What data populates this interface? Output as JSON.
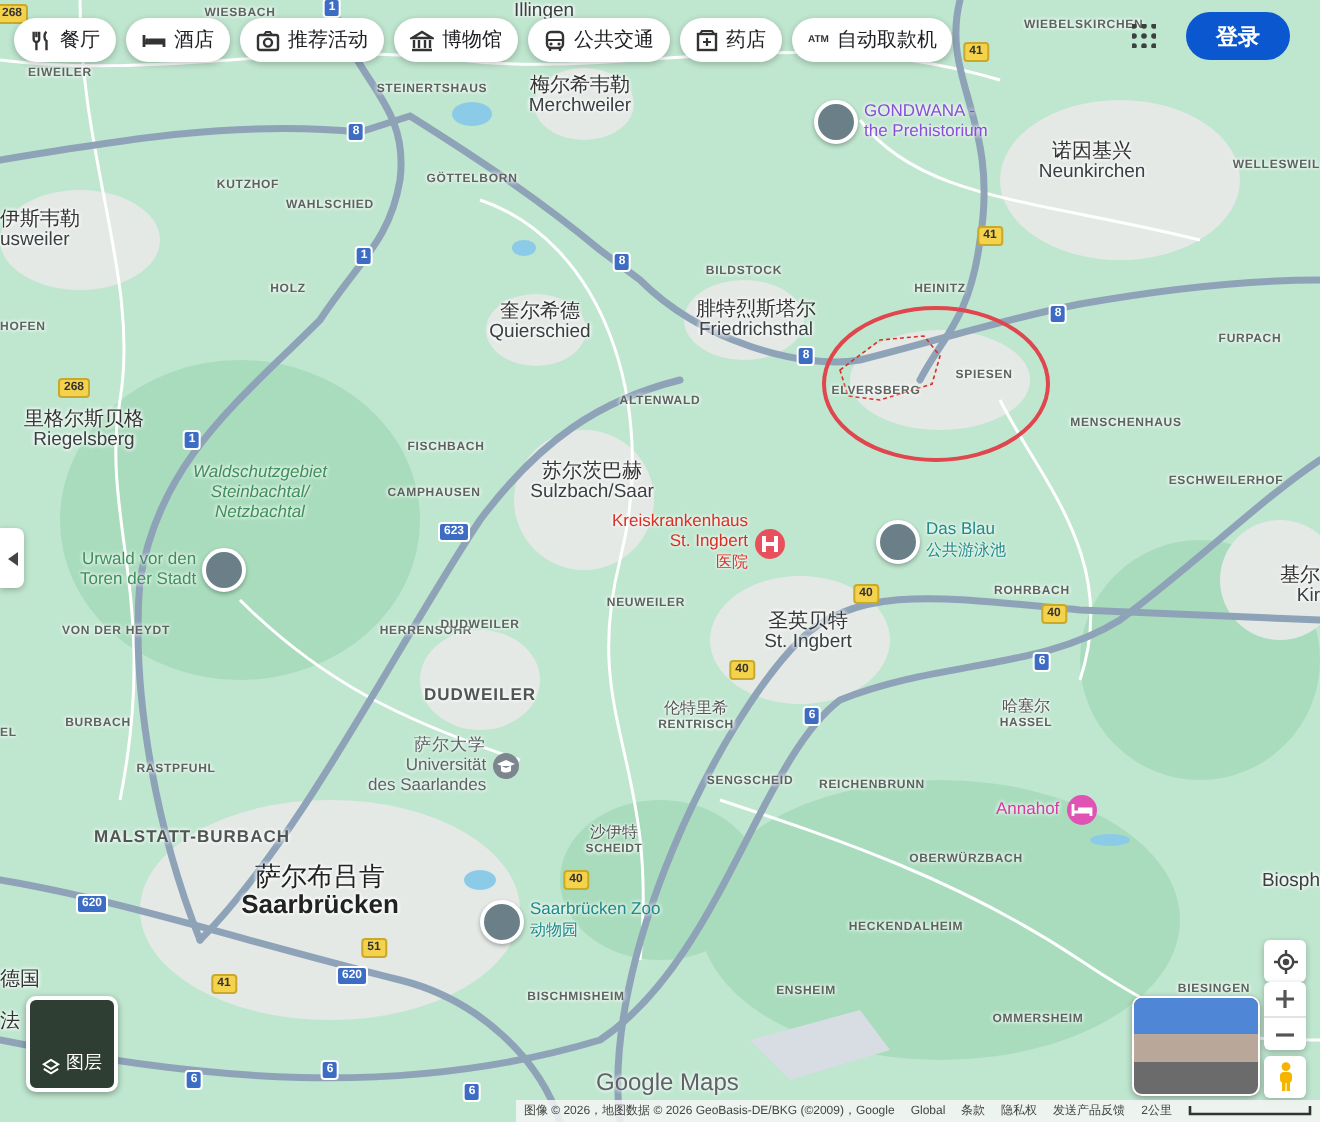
{
  "categories": [
    {
      "kind": "restaurant",
      "label": "餐厅"
    },
    {
      "kind": "hotel",
      "label": "酒店"
    },
    {
      "kind": "activity",
      "label": "推荐活动"
    },
    {
      "kind": "museum",
      "label": "博物馆"
    },
    {
      "kind": "transit",
      "label": "公共交通"
    },
    {
      "kind": "pharmacy",
      "label": "药店"
    },
    {
      "kind": "atm",
      "label": "自动取款机",
      "badge": "ATM"
    }
  ],
  "sign_in": "登录",
  "places": [
    {
      "kind": "locality",
      "text": "WIESBACH"
    },
    {
      "kind": "locality",
      "text": "EIWEILER"
    },
    {
      "kind": "locality",
      "text": "STEINERTSHAUS"
    },
    {
      "kind": "locality",
      "text": "KUTZHOF"
    },
    {
      "kind": "locality",
      "text": "WAHLSCHIED"
    },
    {
      "kind": "locality",
      "text": "GÖTTELBORN"
    },
    {
      "kind": "locality",
      "text": "HOLZ"
    },
    {
      "kind": "locality",
      "text": "HOFEN"
    },
    {
      "kind": "locality",
      "text": "WIEBELSKIRCHEN"
    },
    {
      "kind": "locality",
      "text": "WELLESWEIL"
    },
    {
      "kind": "locality",
      "text": "BILDSTOCK"
    },
    {
      "kind": "locality",
      "text": "HEINITZ"
    },
    {
      "kind": "locality",
      "text": "FURPACH"
    },
    {
      "kind": "locality",
      "text": "SPIESEN"
    },
    {
      "kind": "locality",
      "text": "ELVERSBERG"
    },
    {
      "kind": "locality",
      "text": "MENSCHENHAUS"
    },
    {
      "kind": "locality",
      "text": "ESCHWEILERHOF"
    },
    {
      "kind": "locality",
      "text": "ALTENWALD"
    },
    {
      "kind": "locality",
      "text": "FISCHBACH"
    },
    {
      "kind": "locality",
      "text": "CAMPHAUSEN"
    },
    {
      "kind": "locality",
      "text": "NEUWEILER"
    },
    {
      "kind": "locality",
      "text": "VON DER HEYDT"
    },
    {
      "kind": "locality",
      "text": "HERRENSOHR"
    },
    {
      "kind": "locality",
      "text": "DUDWEILER"
    },
    {
      "kind": "district",
      "text": "DUDWEILER"
    },
    {
      "kind": "locality",
      "text": "ROHRBACH"
    },
    {
      "kind": "locality",
      "text": "BURBACH"
    },
    {
      "kind": "locality",
      "text": "EL"
    },
    {
      "kind": "locality",
      "text": "RASTPFUHL"
    },
    {
      "kind": "district",
      "text": "MALSTATT-BURBACH"
    },
    {
      "kind": "locality",
      "text": "SENGSCHEID"
    },
    {
      "kind": "locality",
      "text": "REICHENBRUNN"
    },
    {
      "kind": "locality",
      "text": "OBERWÜRZBACH"
    },
    {
      "kind": "locality",
      "text": "HECKENDALHEIM"
    },
    {
      "kind": "locality",
      "text": "ENSHEIM"
    },
    {
      "kind": "locality",
      "text": "OMMERSHEIM"
    },
    {
      "kind": "locality",
      "text": "BIESINGEN"
    },
    {
      "kind": "locality",
      "text": "BISCHMISHEIM"
    }
  ],
  "towns": [
    {
      "kind": "town",
      "name": "Illingen"
    },
    {
      "kind": "town",
      "name_zh": "梅尔希韦勒",
      "name": "Merchweiler"
    },
    {
      "kind": "town",
      "name_zh": "伊斯韦勒",
      "name": "usweiler"
    },
    {
      "kind": "town",
      "name_zh": "奎尔希德",
      "name": "Quierschied"
    },
    {
      "kind": "town",
      "name_zh": "腓特烈斯塔尔",
      "name": "Friedrichsthal"
    },
    {
      "kind": "town",
      "name_zh": "诺因基兴",
      "name": "Neunkirchen"
    },
    {
      "kind": "town",
      "name_zh": "里格尔斯贝格",
      "name": "Riegelsberg"
    },
    {
      "kind": "town",
      "name_zh": "苏尔茨巴赫",
      "name": "Sulzbach/Saar"
    },
    {
      "kind": "town",
      "name_zh": "圣英贝特",
      "name": "St. Ingbert"
    },
    {
      "kind": "town",
      "name_zh": "基尔",
      "name": "Kir"
    },
    {
      "kind": "minor",
      "name_zh": "伦特里希",
      "name": "RENTRISCH"
    },
    {
      "kind": "minor",
      "name_zh": "哈塞尔",
      "name": "HASSEL"
    },
    {
      "kind": "minor",
      "name_zh": "沙伊特",
      "name": "SCHEIDT"
    },
    {
      "kind": "city",
      "name_zh": "萨尔布吕肯",
      "name": "Saarbrücken"
    },
    {
      "kind": "town",
      "name_zh": "德国"
    },
    {
      "kind": "town",
      "name_zh": "法"
    },
    {
      "kind": "town",
      "name": "Biosph"
    }
  ],
  "pois": [
    {
      "kind": "museum",
      "lines": [
        "GONDWANA -",
        "the Prehistorium"
      ]
    },
    {
      "kind": "reserve",
      "lines": [
        "Waldschutzgebiet",
        "Steinbachtal/",
        "Netzbachtal"
      ]
    },
    {
      "kind": "park",
      "lines": [
        "Urwald vor den",
        "Toren der Stadt"
      ]
    },
    {
      "kind": "hospital",
      "lines": [
        "Kreiskrankenhaus",
        "St. Ingbert"
      ],
      "sub": "医院"
    },
    {
      "kind": "pool",
      "lines": [
        "Das Blau"
      ],
      "sub": "公共游泳池"
    },
    {
      "kind": "university",
      "lines": [
        "萨尔大学",
        "Universität",
        "des Saarlandes"
      ]
    },
    {
      "kind": "zoo",
      "lines": [
        "Saarbrücken Zoo"
      ],
      "sub": "动物园"
    },
    {
      "kind": "hotel",
      "lines": [
        "Annahof"
      ]
    }
  ],
  "road_shields": [
    {
      "kind": "autobahn",
      "number": "1"
    },
    {
      "kind": "autobahn",
      "number": "8"
    },
    {
      "kind": "autobahn",
      "number": "1"
    },
    {
      "kind": "autobahn",
      "number": "8"
    },
    {
      "kind": "federal",
      "number": "268"
    },
    {
      "kind": "federal",
      "number": "268"
    },
    {
      "kind": "autobahn",
      "number": "1"
    },
    {
      "kind": "autobahn",
      "number": "623"
    },
    {
      "kind": "federal",
      "number": "41"
    },
    {
      "kind": "federal",
      "number": "41"
    },
    {
      "kind": "autobahn",
      "number": "8"
    },
    {
      "kind": "autobahn",
      "number": "8"
    },
    {
      "kind": "federal",
      "number": "40"
    },
    {
      "kind": "federal",
      "number": "40"
    },
    {
      "kind": "federal",
      "number": "40"
    },
    {
      "kind": "autobahn",
      "number": "6"
    },
    {
      "kind": "autobahn",
      "number": "6"
    },
    {
      "kind": "autobahn",
      "number": "620"
    },
    {
      "kind": "federal",
      "number": "51"
    },
    {
      "kind": "autobahn",
      "number": "620"
    },
    {
      "kind": "federal",
      "number": "41"
    },
    {
      "kind": "autobahn",
      "number": "6"
    },
    {
      "kind": "autobahn",
      "number": "6"
    },
    {
      "kind": "autobahn",
      "number": "6"
    },
    {
      "kind": "federal",
      "number": "40"
    }
  ],
  "layers_label": "图层",
  "logo": "Google Maps",
  "footer": {
    "attribution": "图像 © 2026，地图数据 © 2026 GeoBasis-DE/BKG (©2009)，Google",
    "links": [
      "Global",
      "条款",
      "隐私权",
      "发送产品反馈"
    ],
    "scale": "2公里"
  }
}
